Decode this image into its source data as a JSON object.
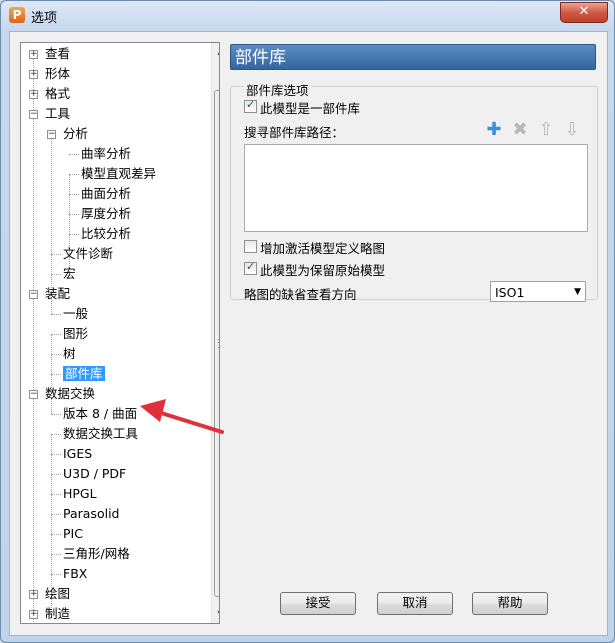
{
  "window": {
    "title": "选项",
    "app_icon_letter": "P",
    "close_glyph": "✕"
  },
  "tree": {
    "items": [
      {
        "label": "查看",
        "expander": "+"
      },
      {
        "label": "形体",
        "expander": "+"
      },
      {
        "label": "格式",
        "expander": "+"
      },
      {
        "label": "工具",
        "expander": "−"
      },
      {
        "label": "分析",
        "expander": "−"
      },
      {
        "label": "曲率分析"
      },
      {
        "label": "模型直观差异"
      },
      {
        "label": "曲面分析"
      },
      {
        "label": "厚度分析"
      },
      {
        "label": "比较分析"
      },
      {
        "label": "文件诊断"
      },
      {
        "label": "宏"
      },
      {
        "label": "装配",
        "expander": "−"
      },
      {
        "label": "一般"
      },
      {
        "label": "图形"
      },
      {
        "label": "树"
      },
      {
        "label": "部件库",
        "selected": true
      },
      {
        "label": "数据交换",
        "expander": "−"
      },
      {
        "label": "版本 8 / 曲面"
      },
      {
        "label": "数据交换工具"
      },
      {
        "label": "IGES"
      },
      {
        "label": "U3D / PDF"
      },
      {
        "label": "HPGL"
      },
      {
        "label": "Parasolid"
      },
      {
        "label": "PIC"
      },
      {
        "label": "三角形/网格"
      },
      {
        "label": "FBX"
      },
      {
        "label": "绘图",
        "expander": "+"
      },
      {
        "label": "制造",
        "expander": "+"
      }
    ],
    "scroll_up": "▲",
    "scroll_down": "▼"
  },
  "panel": {
    "header": "部件库",
    "group_title": "部件库选项",
    "is_library_label": "此模型是一部件库",
    "is_library_checked": true,
    "search_path_label": "搜寻部件库路径：",
    "tools": {
      "add": "✚",
      "delete": "✖",
      "up": "⇧",
      "down": "⇩"
    },
    "add_sketch_label": "增加激活模型定义略图",
    "add_sketch_checked": false,
    "keep_original_label": "此模型为保留原始模型",
    "keep_original_checked": true,
    "view_dir_label": "略图的缺省查看方向",
    "view_dir_value": "ISO1",
    "dropdown_glyph": "▼"
  },
  "buttons": {
    "ok": "接受",
    "cancel": "取消",
    "help": "帮助"
  },
  "colors": {
    "header_bg": "#4a7cb5",
    "selection": "#3399ff",
    "annotation_arrow": "#e0313a"
  }
}
